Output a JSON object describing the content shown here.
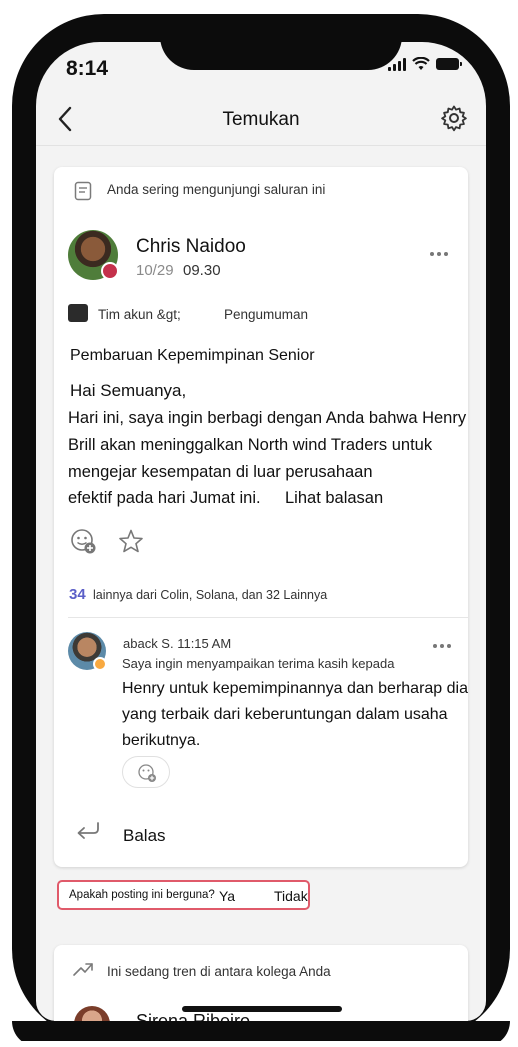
{
  "status_bar": {
    "time": "8:14"
  },
  "header": {
    "title": "Temukan"
  },
  "card": {
    "context_text": "Anda sering mengunjungi saluran ini",
    "author": {
      "name": "Chris Naidoo",
      "date": "10/29",
      "time": "09.30"
    },
    "channel": {
      "team": "Tim akun &gt;",
      "channel": "Pengumuman"
    },
    "post_title": "Pembaruan Kepemimpinan Senior",
    "greeting": "Hai Semuanya,",
    "body_lines": [
      "Hari ini, saya ingin berbagi dengan Anda bahwa Henry",
      "Brill akan meninggalkan North wind Traders untuk",
      "mengejar kesempatan di luar perusahaan",
      "efektif pada hari Jumat ini."
    ],
    "see_replies": "Lihat balasan",
    "replies_count": "34",
    "replies_text": "lainnya dari Colin, Solana, dan 32 Lainnya",
    "reply": {
      "author_time": "aback S. 11:15 AM",
      "line1": "Saya ingin menyampaikan terima kasih kepada",
      "lines": [
        "Henry untuk kepemimpinannya dan berharap dia",
        "yang terbaik dari keberuntungan dalam usaha",
        "berikutnya."
      ]
    },
    "reply_button": "Balas"
  },
  "feedback": {
    "question": "Apakah posting ini berguna?",
    "yes": "Ya",
    "no": "Tidak"
  },
  "card2": {
    "context_text": "Ini sedang tren di antara kolega Anda",
    "author_name": "Sirena Ribeiro"
  },
  "colors": {
    "accent": "#5b5fc7",
    "presence_busy": "#c4314b",
    "presence_away": "#f8a940",
    "highlight_border": "#e05a6a"
  }
}
